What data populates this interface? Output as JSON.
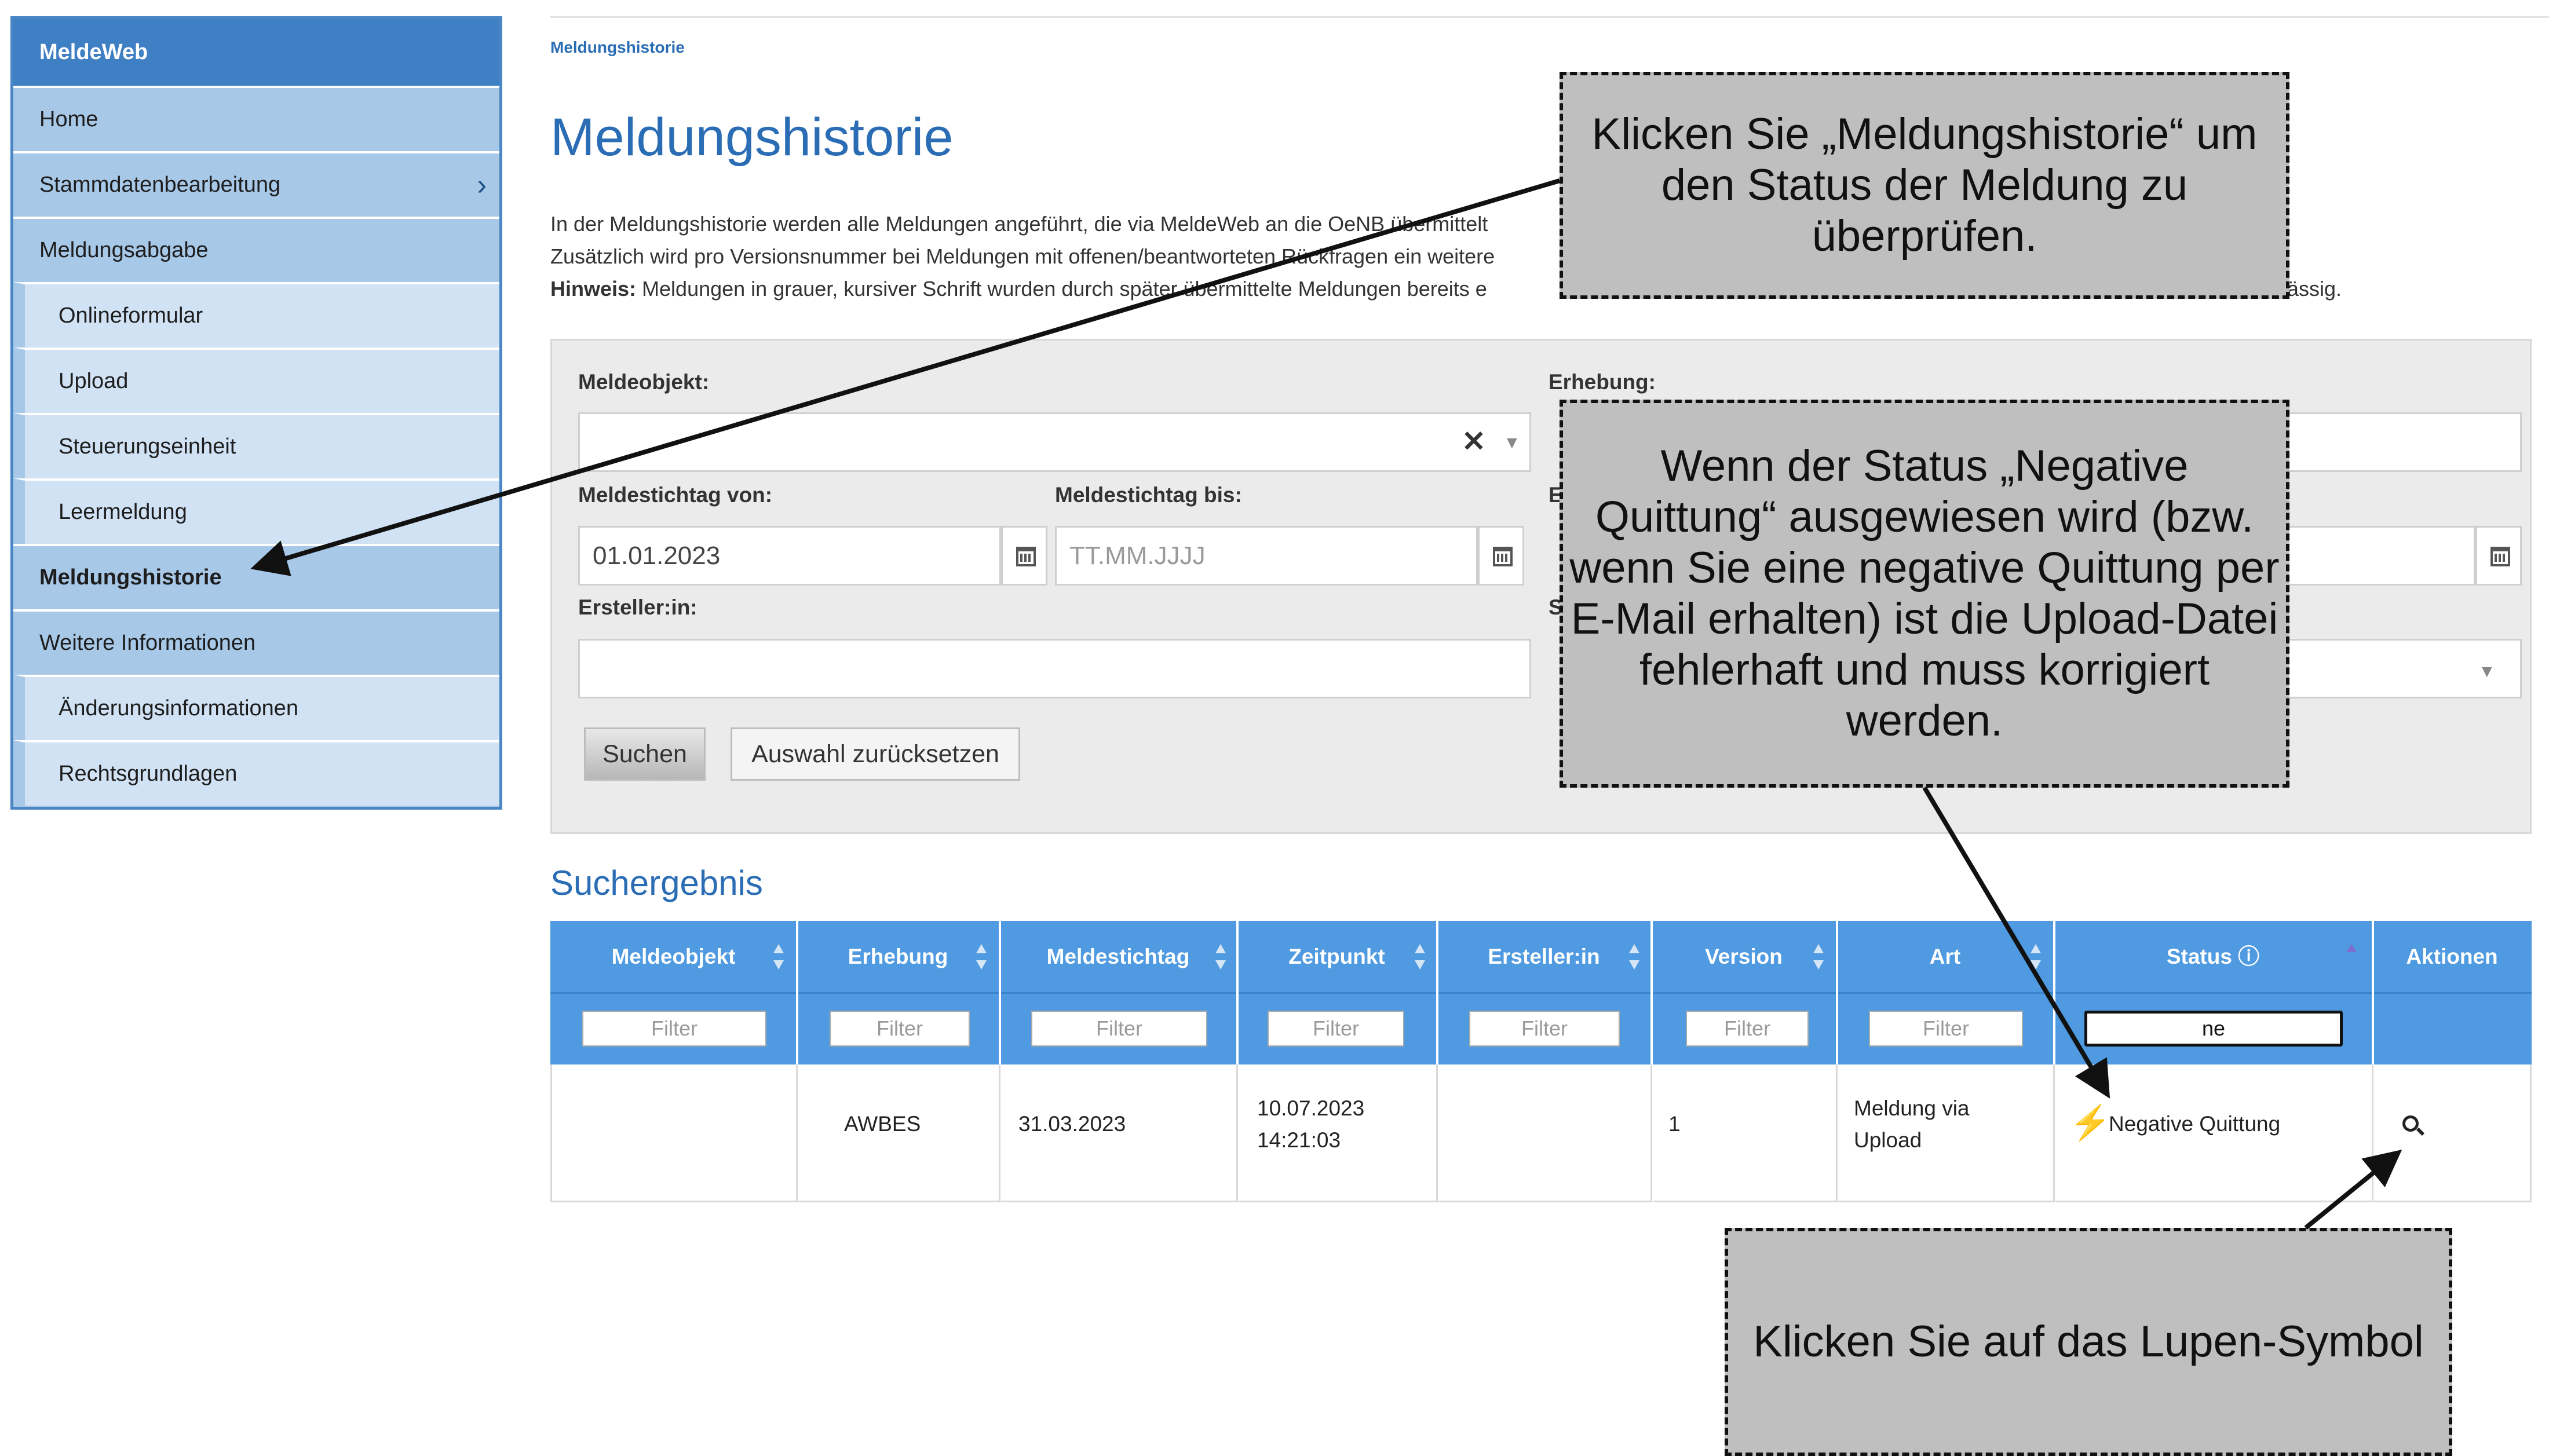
{
  "sidebar": {
    "title": "MeldeWeb",
    "items": [
      {
        "label": "Home"
      },
      {
        "label": "Stammdatenbearbeitung"
      },
      {
        "label": "Meldungsabgabe"
      },
      {
        "label": "Onlineformular"
      },
      {
        "label": "Upload"
      },
      {
        "label": "Steuerungseinheit"
      },
      {
        "label": "Leermeldung"
      },
      {
        "label": "Meldungshistorie"
      },
      {
        "label": "Weitere Informationen"
      },
      {
        "label": "Änderungsinformationen"
      },
      {
        "label": "Rechtsgrundlagen"
      }
    ]
  },
  "breadcrumb": "Meldungshistorie",
  "page_title": "Meldungshistorie",
  "intro": {
    "line1": "In der Meldungshistorie werden alle Meldungen angeführt, die via MeldeWeb an die OeNB übermittelt",
    "line2": "Zusätzlich wird pro Versionsnummer bei Meldungen mit offenen/beantworteten Rückfragen ein weitere",
    "line3_bold": "Hinweis:",
    "line3": "Meldungen in grauer, kursiver Schrift wurden durch später übermittelte Meldungen bereits e",
    "line3_tail": "lässig."
  },
  "form": {
    "meldeobjekt_label": "Meldeobjekt:",
    "erhebung_label": "Erhebung:",
    "von_label": "Meldestichtag von:",
    "von_value": "01.01.2023",
    "bis_label": "Meldestichtag bis:",
    "bis_placeholder": "TT.MM.JJJJ",
    "stub_b": "E",
    "stub_s": "S",
    "ersteller_label": "Ersteller:in:",
    "clear_symbol": "✕",
    "search_button": "Suchen",
    "reset_button": "Auswahl zurücksetzen"
  },
  "results_title": "Suchergebnis",
  "table": {
    "columns": [
      "Meldeobjekt",
      "Erhebung",
      "Meldestichtag",
      "Zeitpunkt",
      "Ersteller:in",
      "Version",
      "Art",
      "Status",
      "Aktionen"
    ],
    "status_info_symbol": "ⓘ",
    "filter_placeholder": "Filter",
    "status_filter_value": "ne",
    "row": {
      "meldeobjekt": "",
      "erhebung": "AWBES",
      "meldestichtag": "31.03.2023",
      "zeitpunkt_date": "10.07.2023",
      "zeitpunkt_time": "14:21:03",
      "ersteller": "",
      "version": "1",
      "art_line1": "Meldung via",
      "art_line2": "Upload",
      "status": "Negative Quittung",
      "status_icon": "lightning-icon",
      "action_icon": "magnifier-icon"
    }
  },
  "callouts": {
    "c1": "Klicken Sie „Meldungshistorie“ um\nden Status der Meldung zu\nüberprüfen.",
    "c2": "Wenn der Status „Negative\nQuittung“ ausgewiesen wird (bzw.\nwenn Sie eine negative Quittung per\nE-Mail erhalten) ist die Upload-Datei\nfehlerhaft und muss korrigiert\nwerden.",
    "c3": "Klicken Sie auf das Lupen-Symbol"
  },
  "colors": {
    "brand_blue": "#3f7fc3",
    "table_header": "#4f9ae0",
    "link_blue": "#2a6db5",
    "status_error": "#e8322b",
    "callout_bg": "#bfbfbf"
  }
}
